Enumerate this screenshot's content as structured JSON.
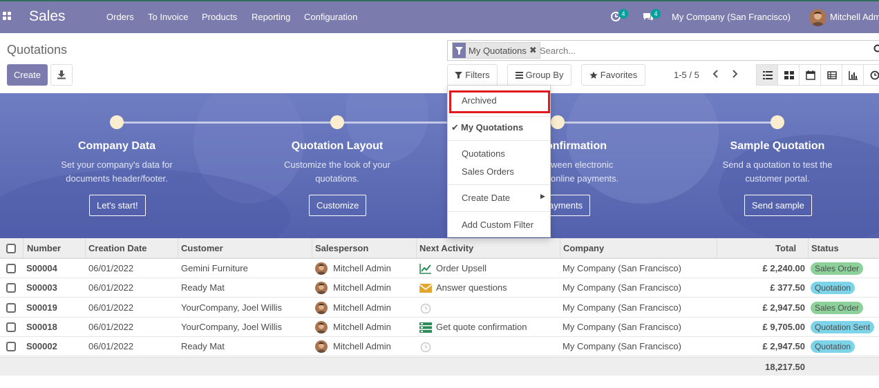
{
  "navbar": {
    "app_name": "Sales",
    "menu": [
      "Orders",
      "To Invoice",
      "Products",
      "Reporting",
      "Configuration"
    ],
    "activity_count": "4",
    "message_count": "4",
    "company": "My Company (San Francisco)",
    "user": "Mitchell Admin",
    "bg_color": "#7c7bad"
  },
  "control_panel": {
    "title": "Quotations",
    "create_label": "Create",
    "facet_label": "My Quotations",
    "search_placeholder": "Search...",
    "filters_label": "Filters",
    "groupby_label": "Group By",
    "favorites_label": "Favorites",
    "pager": "1-5 / 5"
  },
  "filters_dropdown": {
    "items": [
      "Archived",
      "My Quotations",
      "Quotations",
      "Sales Orders",
      "Create Date",
      "Add Custom Filter"
    ],
    "checked": "My Quotations",
    "highlighted": "Archived"
  },
  "banner": {
    "steps": [
      {
        "title": "Company Data",
        "desc1": "Set your company's data for",
        "desc2": "documents header/footer.",
        "button": "Let's start!"
      },
      {
        "title": "Quotation Layout",
        "desc1": "Customize the look of your",
        "desc2": "quotations.",
        "button": "Customize"
      },
      {
        "title": "onfirmation",
        "desc1": "ween electronic",
        "desc2": "online payments.",
        "button": "ayments"
      },
      {
        "title": "Sample Quotation",
        "desc1": "Send a quotation to test the",
        "desc2": "customer portal.",
        "button": "Send sample"
      }
    ]
  },
  "table": {
    "headers": [
      "Number",
      "Creation Date",
      "Customer",
      "Salesperson",
      "Next Activity",
      "Company",
      "Total",
      "Status"
    ],
    "rows": [
      {
        "number": "S00004",
        "date": "06/01/2022",
        "customer": "Gemini Furniture",
        "salesperson": "Mitchell Admin",
        "activity": "Order Upsell",
        "activity_icon": "chart-line-icon",
        "company": "My Company (San Francisco)",
        "total": "£ 2,240.00",
        "status": "Sales Order",
        "status_color": "green"
      },
      {
        "number": "S00003",
        "date": "06/01/2022",
        "customer": "Ready Mat",
        "salesperson": "Mitchell Admin",
        "activity": "Answer questions",
        "activity_icon": "envelope-icon",
        "company": "My Company (San Francisco)",
        "total": "£ 377.50",
        "status": "Quotation",
        "status_color": "blue"
      },
      {
        "number": "S00019",
        "date": "06/01/2022",
        "customer": "YourCompany, Joel Willis",
        "salesperson": "Mitchell Admin",
        "activity": "",
        "activity_icon": "clock-icon",
        "company": "My Company (San Francisco)",
        "total": "£ 2,947.50",
        "status": "Sales Order",
        "status_color": "green"
      },
      {
        "number": "S00018",
        "date": "06/01/2022",
        "customer": "YourCompany, Joel Willis",
        "salesperson": "Mitchell Admin",
        "activity": "Get quote confirmation",
        "activity_icon": "tasks-icon",
        "company": "My Company (San Francisco)",
        "total": "£ 9,705.00",
        "status": "Quotation Sent",
        "status_color": "blue"
      },
      {
        "number": "S00002",
        "date": "06/01/2022",
        "customer": "Ready Mat",
        "salesperson": "Mitchell Admin",
        "activity": "",
        "activity_icon": "clock-icon",
        "company": "My Company (San Francisco)",
        "total": "£ 2,947.50",
        "status": "Quotation",
        "status_color": "blue"
      }
    ],
    "grand_total": "18,217.50"
  }
}
